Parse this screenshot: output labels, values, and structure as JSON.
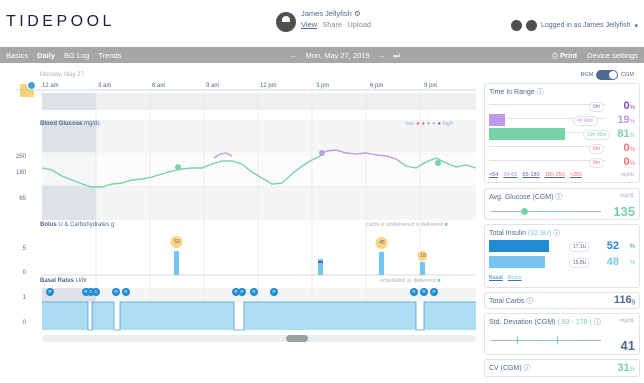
{
  "header": {
    "logo": "TIDEPOOL",
    "patient_name": "James Jellyfish",
    "links": [
      "View",
      "Share",
      "Upload"
    ],
    "login_text": "Logged in as James Jellyfish"
  },
  "nav": {
    "tabs": [
      "Basics",
      "Daily",
      "BG Log",
      "Trends"
    ],
    "active_tab": "Daily",
    "date": "Mon, May 27, 2019",
    "print_label": "Print",
    "settings_label": "Device settings"
  },
  "daily": {
    "day_label": "Monday, May 27",
    "hours": [
      "12 am",
      "3 am",
      "6 am",
      "9 am",
      "12 pm",
      "3 pm",
      "6 pm",
      "9 pm"
    ],
    "bg_title": "Blood Glucose",
    "bg_unit": "mg/dL",
    "bg_legend_low": "low",
    "bg_legend_high": "high",
    "bg_ticks": [
      "250",
      "180",
      "65"
    ],
    "bolus_title": "Bolus",
    "bolus_unit": "U & Carbohydrates",
    "bolus_unit2": "g",
    "bolus_legend": [
      "carbs",
      "undelivered",
      "delivered"
    ],
    "bolus_ticks": [
      "5",
      "0"
    ],
    "carbs": [
      "53",
      "45",
      "18"
    ],
    "basal_title": "Basal Rates",
    "basal_unit": "U/hr",
    "basal_legend": [
      "scheduled",
      "delivered"
    ],
    "basal_ticks": [
      "1",
      "0"
    ],
    "basal_markers": [
      "R",
      "R",
      "C",
      "C",
      "R",
      "R",
      "R",
      "R",
      "R",
      "R",
      "R",
      "R",
      "R"
    ]
  },
  "sidebar": {
    "toggle_left": "BGM",
    "toggle_right": "CGM",
    "tir_title": "Time In Range",
    "tir": [
      {
        "time": "0m",
        "pct": "0",
        "color": "#7f4cbf"
      },
      {
        "time": "4h 40m",
        "pct": "19",
        "color": "#bb9ae7"
      },
      {
        "time": "19h 20m",
        "pct": "81",
        "color": "#76d3a6"
      },
      {
        "time": "0m",
        "pct": "0",
        "color": "#fc6d73"
      },
      {
        "time": "0m",
        "pct": "0",
        "color": "#fc6d73"
      }
    ],
    "ranges": [
      "<54",
      "54-65",
      "65-180",
      "180-250",
      ">250"
    ],
    "tir_units": "mg/dL",
    "avg_title": "Avg. Glucose (CGM)",
    "avg_unit": "mg/dL",
    "avg_value": "135",
    "insulin_title": "Total Insulin",
    "insulin_total": "32.9U",
    "basal_amt": "17.1U",
    "basal_pct": "52",
    "bolus_amt": "15.8U",
    "bolus_pct": "48",
    "insulin_tabs": [
      "Basal",
      "Bolus"
    ],
    "carbs_title": "Total Carbs",
    "carbs_value": "116",
    "carbs_unit": "g",
    "sd_title": "Std. Deviation (CGM)",
    "sd_range": "( 93 - 178 )",
    "sd_unit": "mg/dL",
    "sd_value": "41",
    "cv_title": "CV (CGM)",
    "cv_value": "31",
    "pct_sign": "%"
  }
}
